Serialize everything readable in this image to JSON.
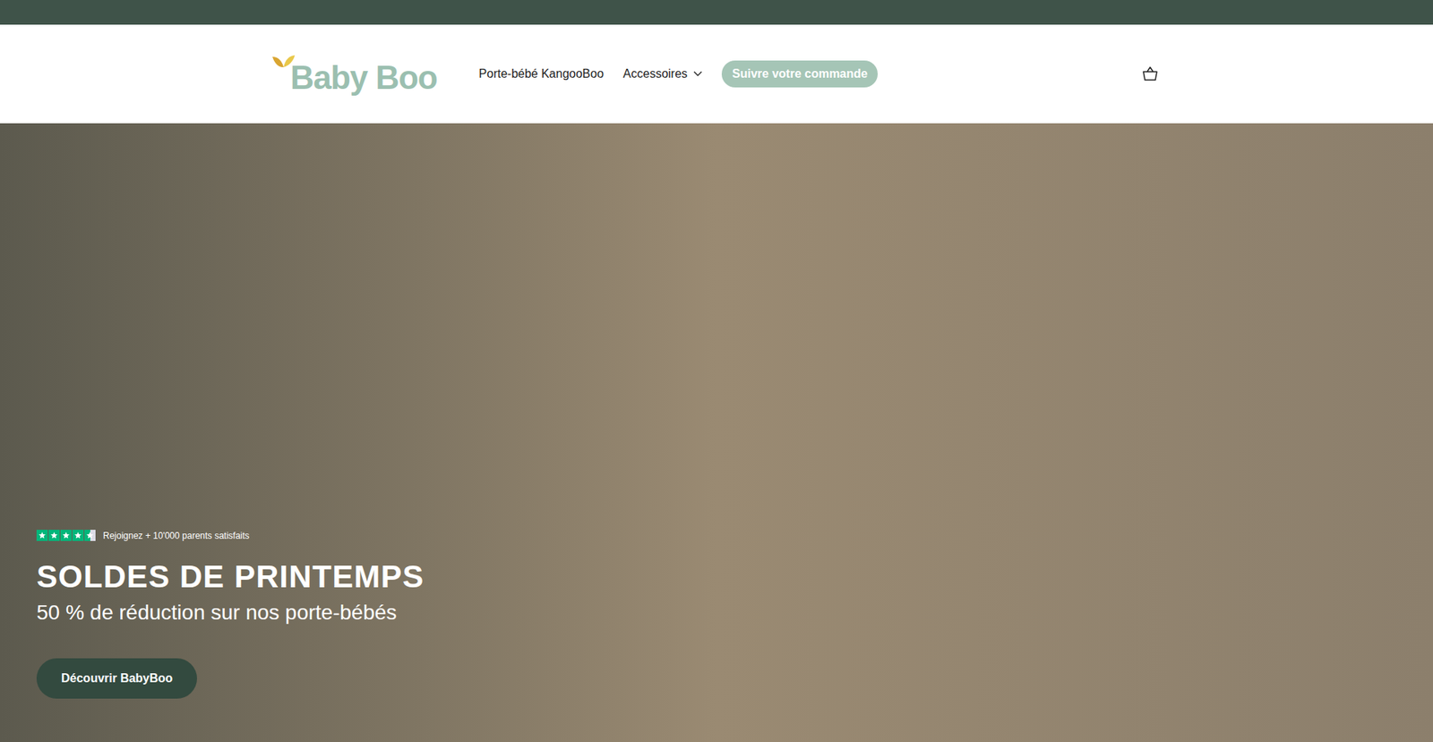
{
  "announcement_bar": {
    "text": ""
  },
  "header": {
    "logo": "Baby Boo",
    "nav": [
      {
        "label": "Porte-bébé KangooBoo",
        "kind": "link"
      },
      {
        "label": "Accessoires",
        "kind": "dropdown"
      },
      {
        "label": "Suivre votre commande",
        "kind": "pill"
      }
    ]
  },
  "hero": {
    "rating": {
      "stars": 4.5,
      "text": "Rejoignez + 10'000 parents satisfaits"
    },
    "title": "SOLDES DE PRINTEMPS",
    "subtitle": "50 % de réduction sur nos porte-bébés",
    "button": "Découvrir BabyBoo"
  }
}
